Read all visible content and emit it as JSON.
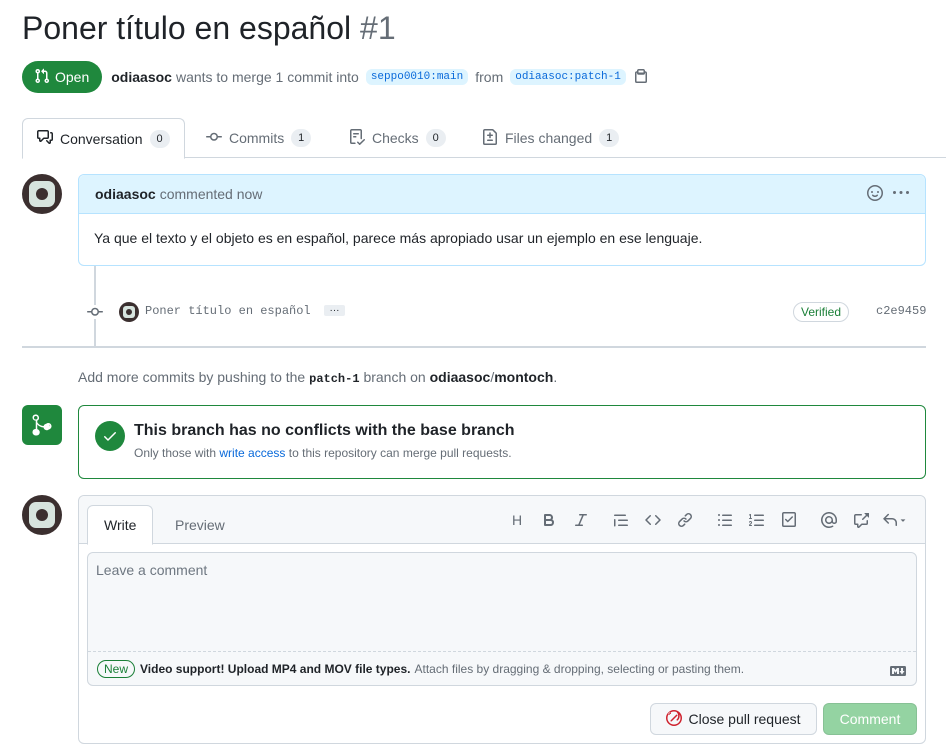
{
  "pr": {
    "title": "Poner título en español",
    "number": "#1",
    "state": "Open",
    "author": "odiaasoc",
    "merge_text": "wants to merge 1 commit into",
    "base_branch": "seppo0010:main",
    "from_text": "from",
    "head_branch": "odiaasoc:patch-1"
  },
  "tabs": [
    {
      "label": "Conversation",
      "count": "0"
    },
    {
      "label": "Commits",
      "count": "1"
    },
    {
      "label": "Checks",
      "count": "0"
    },
    {
      "label": "Files changed",
      "count": "1"
    }
  ],
  "comment": {
    "author": "odiaasoc",
    "meta": "commented now",
    "body": "Ya que el texto y el objeto es en español, parece más apropiado usar un ejemplo en ese lenguaje."
  },
  "commit": {
    "message": "Poner título en español",
    "ellipsis": "···",
    "verified": "Verified",
    "sha": "c2e9459"
  },
  "push_hint": {
    "prefix": "Add more commits by pushing to the",
    "branch": "patch-1",
    "middle": "branch on",
    "owner": "odiaasoc",
    "slash": "/",
    "repo": "montoch",
    "suffix": "."
  },
  "merge": {
    "title": "This branch has no conflicts with the base branch",
    "sub_prefix": "Only those with",
    "sub_link": "write access",
    "sub_suffix": "to this repository can merge pull requests."
  },
  "editor": {
    "tab_write": "Write",
    "tab_preview": "Preview",
    "toolbar_heading": "H",
    "placeholder": "Leave a comment",
    "new_badge": "New",
    "attach_bold": "Video support! Upload MP4 and MOV file types.",
    "attach_text": "Attach files by dragging & dropping, selecting or pasting them."
  },
  "buttons": {
    "close_pr": "Close pull request",
    "comment": "Comment"
  },
  "colors": {
    "open_green": "#1f883d",
    "link_blue": "#0969da",
    "comment_header_bg": "#ddf4ff",
    "comment_button_disabled": "#94d3a2",
    "close_icon_red": "#cf222e"
  }
}
